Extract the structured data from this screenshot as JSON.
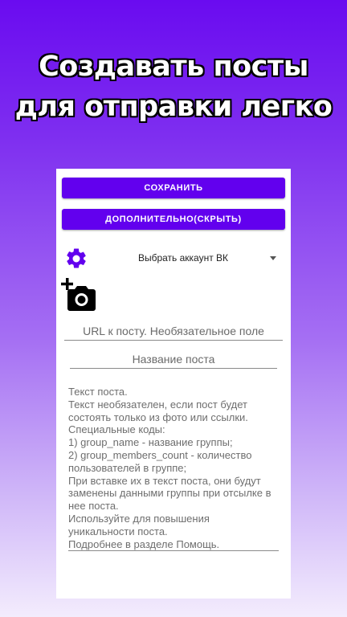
{
  "headline": {
    "line1": "Создавать посты",
    "line2": "для отправки легко"
  },
  "toolbar": {
    "save_label": "СОХРАНИТЬ",
    "more_label": "ДОПОЛНИТЕЛЬНО(СКРЫТЬ)"
  },
  "account": {
    "selected": "Выбрать аккаунт ВК"
  },
  "icons": {
    "settings": "gear-icon",
    "add_photo": "add-photo-camera-icon",
    "dropdown": "chevron-down-icon"
  },
  "fields": {
    "url_placeholder": "URL к посту. Необязательное поле",
    "name_placeholder": "Название поста",
    "text_placeholder": "Текст поста.\nТекст необязателен, если пост будет состоять только из фото или ссылки.\nСпециальные коды:\n1) group_name - название группы;\n2) group_members_count - количество пользователей в группе;\nПри вставке их в текст поста, они будут заменены данными группы при отсылке в нее поста.\nИспользуйте для повышения уникальности поста.\nПодробнее в разделе Помощь."
  },
  "colors": {
    "accent": "#6200ee",
    "gradient_top": "#6a0bf0",
    "gradient_bottom": "#f3ecfd",
    "icon": "#6200ee"
  }
}
